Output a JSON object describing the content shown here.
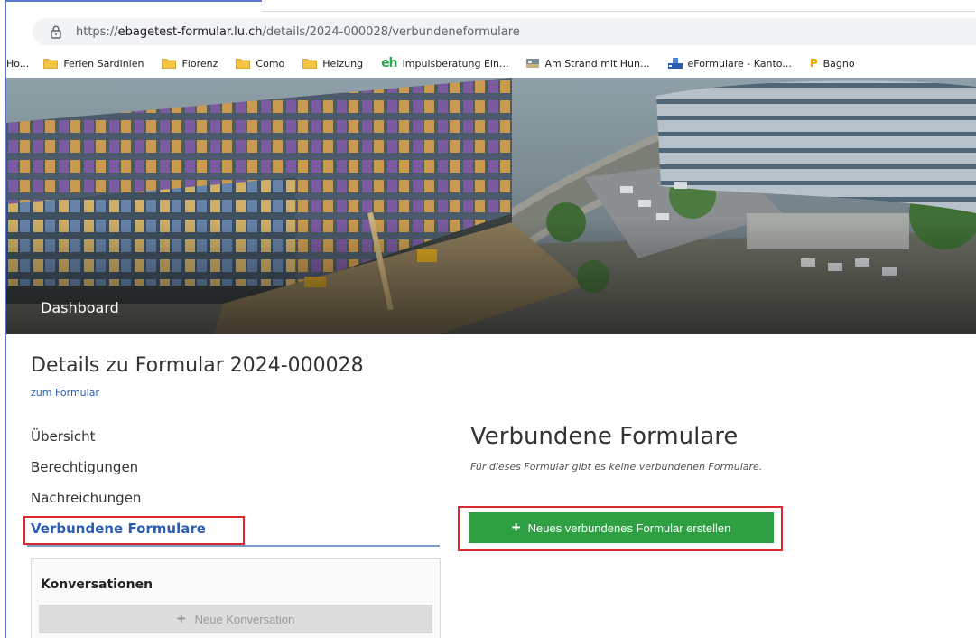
{
  "browser": {
    "url_prefix": "https://",
    "url_host": "ebagetest-formular.lu.ch",
    "url_path": "/details/2024-000028/verbundeneformulare"
  },
  "bookmarks": [
    {
      "label": "Ho...",
      "icon": "none"
    },
    {
      "label": "Ferien Sardinien",
      "icon": "folder-icon"
    },
    {
      "label": "Florenz",
      "icon": "folder-icon"
    },
    {
      "label": "Como",
      "icon": "folder-icon"
    },
    {
      "label": "Heizung",
      "icon": "folder-icon"
    },
    {
      "label": "Impulsberatung Ein...",
      "icon": "eh-icon",
      "icon_text": "eh"
    },
    {
      "label": "Am Strand mit Hun...",
      "icon": "beach-icon"
    },
    {
      "label": "eFormulare - Kanto...",
      "icon": "eform-icon"
    },
    {
      "label": "Bagno",
      "icon": "bagno-icon"
    }
  ],
  "hero": {
    "title": "Dashboard"
  },
  "page": {
    "title": "Details zu Formular 2024-000028",
    "back_link": "zum Formular"
  },
  "nav": {
    "items": [
      {
        "label": "Übersicht",
        "active": false
      },
      {
        "label": "Berechtigungen",
        "active": false
      },
      {
        "label": "Nachreichungen",
        "active": false
      },
      {
        "label": "Verbundene Formulare",
        "active": true
      }
    ]
  },
  "conversations": {
    "title": "Konversationen",
    "new_button": "Neue Konversation"
  },
  "main": {
    "title": "Verbundene Formulare",
    "info": "Für dieses Formular gibt es keine verbundenen Formulare.",
    "create_button": "Neues verbundenes Formular erstellen"
  },
  "colors": {
    "link": "#2a5db0",
    "primary_button": "#2ea043",
    "highlight": "#d9282f",
    "folder": "#f5c542"
  }
}
